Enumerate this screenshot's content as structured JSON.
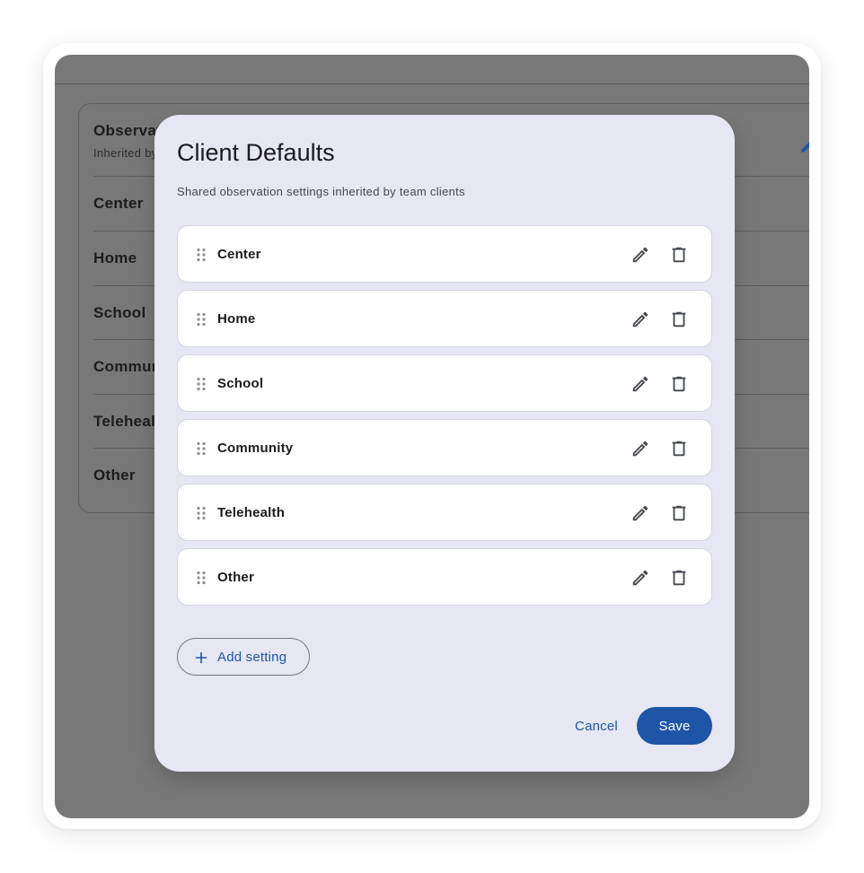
{
  "background_page": {
    "card_title": "Observations",
    "card_subtitle": "Inherited by team clients",
    "rows": [
      "Center",
      "Home",
      "School",
      "Community",
      "Telehealth",
      "Other"
    ]
  },
  "dialog": {
    "title": "Client Defaults",
    "subtitle": "Shared observation settings inherited by team clients",
    "items": [
      {
        "label": "Center"
      },
      {
        "label": "Home"
      },
      {
        "label": "School"
      },
      {
        "label": "Community"
      },
      {
        "label": "Telehealth"
      },
      {
        "label": "Other"
      }
    ],
    "add_label": "Add setting",
    "cancel_label": "Cancel",
    "save_label": "Save"
  },
  "icons": {
    "drag": "drag-handle-icon",
    "edit": "pencil-icon",
    "delete": "trash-icon",
    "add": "plus-icon"
  },
  "colors": {
    "accent": "#1f55a7",
    "scrim": "#787878",
    "dialog_surface": "#e6e7f2",
    "item_surface": "#ffffff"
  }
}
